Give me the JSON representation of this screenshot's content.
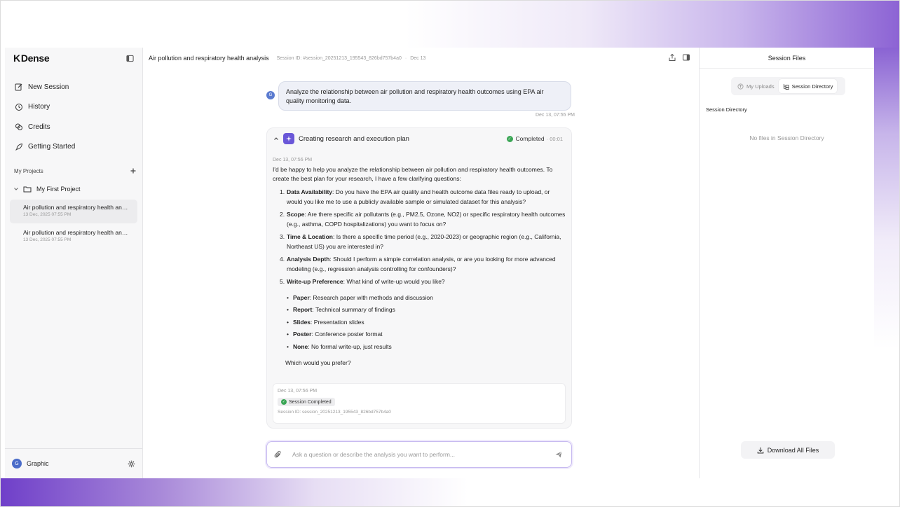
{
  "app": {
    "logo_text": "Dens",
    "logo_suffix": "e"
  },
  "sidebar": {
    "nav": [
      {
        "label": "New Session",
        "icon": "edit-icon"
      },
      {
        "label": "History",
        "icon": "history-icon"
      },
      {
        "label": "Credits",
        "icon": "credits-icon"
      },
      {
        "label": "Getting Started",
        "icon": "rocket-icon"
      }
    ],
    "projects_heading": "My Projects",
    "project": "My First Project",
    "sessions": [
      {
        "title": "Air pollution and respiratory health analysis",
        "date": "13 Dec, 2025 07:55 PM",
        "active": true
      },
      {
        "title": "Air pollution and respiratory health analysis",
        "date": "13 Dec, 2025 07:55 PM",
        "active": false
      }
    ],
    "user": {
      "initial": "G",
      "name": "Graphic"
    }
  },
  "header": {
    "title": "Air pollution and respiratory health analysis",
    "session_id": "Session ID: #session_20251213_195543_826bd757b4a0",
    "separator": "·",
    "date": "Dec 13"
  },
  "chat": {
    "user_initial": "G",
    "user_message": "Analyze the relationship between air pollution and respiratory health outcomes using EPA air quality monitoring data.",
    "user_timestamp": "Dec 13, 07:55 PM",
    "plan": {
      "title": "Creating research and execution plan",
      "status": "Completed",
      "duration": "· 00:01",
      "timestamp": "Dec 13, 07:56 PM",
      "intro": "I'd be happy to help you analyze the relationship between air pollution and respiratory health outcomes. To create the best plan for your research, I have a few clarifying questions:",
      "questions": [
        {
          "num": "1.",
          "term": "Data Availability",
          "text": ": Do you have the EPA air quality and health outcome data files ready to upload, or would you like me to use a publicly available sample or simulated dataset for this analysis?"
        },
        {
          "num": "2.",
          "term": "Scope",
          "text": ": Are there specific air pollutants (e.g., PM2.5, Ozone, NO2) or specific respiratory health outcomes (e.g., asthma, COPD hospitalizations) you want to focus on?"
        },
        {
          "num": "3.",
          "term": "Time & Location",
          "text": ": Is there a specific time period (e.g., 2020-2023) or geographic region (e.g., California, Northeast US) you are interested in?"
        },
        {
          "num": "4.",
          "term": "Analysis Depth",
          "text": ": Should I perform a simple correlation analysis, or are you looking for more advanced modeling (e.g., regression analysis controlling for confounders)?"
        },
        {
          "num": "5.",
          "term": "Write-up Preference",
          "text": ": What kind of write-up would you like?"
        }
      ],
      "options": [
        {
          "term": "Paper",
          "text": ": Research paper with methods and discussion"
        },
        {
          "term": "Report",
          "text": ": Technical summary of findings"
        },
        {
          "term": "Slides",
          "text": ": Presentation slides"
        },
        {
          "term": "Poster",
          "text": ": Conference poster format"
        },
        {
          "term": "None",
          "text": ": No formal write-up, just results"
        }
      ],
      "closing": "Which would you prefer?"
    },
    "session_box": {
      "timestamp": "Dec 13, 07:56 PM",
      "badge": "Session Completed",
      "session_id": "Session ID: session_20251213_195543_826bd757b4a0"
    },
    "composer_placeholder": "Ask a question or describe the analysis you want to perform..."
  },
  "right_panel": {
    "title": "Session Files",
    "tabs": [
      {
        "label": "My Uploads",
        "active": false
      },
      {
        "label": "Session Directory",
        "active": true
      }
    ],
    "section": "Session Directory",
    "empty": "No files in Session Directory",
    "download": "Download All Files"
  },
  "colors": {
    "accent": "#6a57d8",
    "success": "#3aa655",
    "avatar": "#4a6cc9"
  }
}
